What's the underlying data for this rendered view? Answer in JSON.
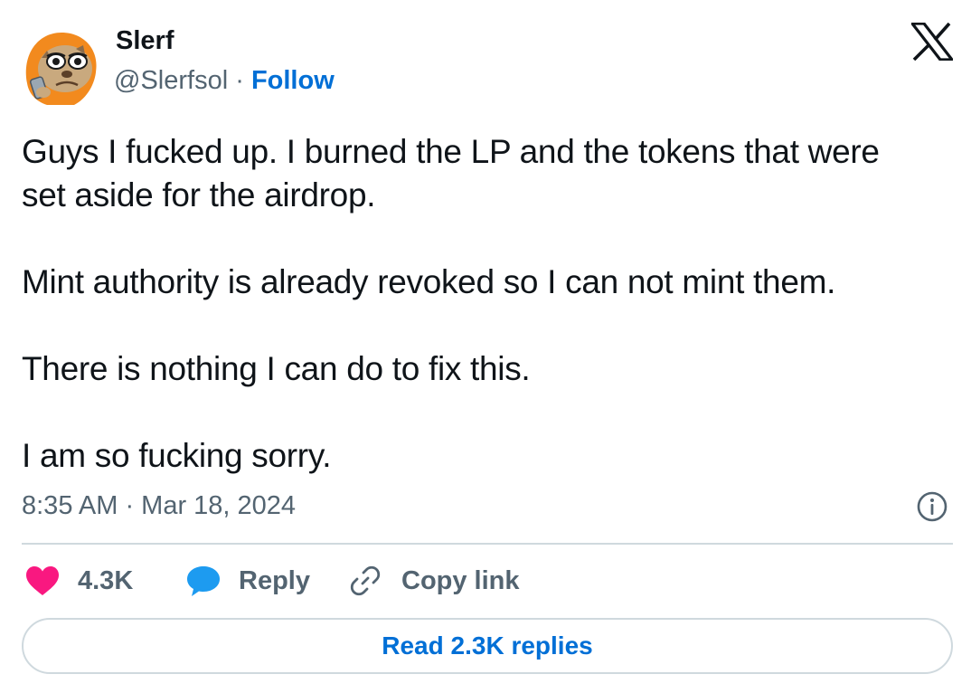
{
  "author": {
    "name": "Slerf",
    "handle": "@Slerfsol",
    "separator": "·",
    "follow_label": "Follow"
  },
  "tweet": {
    "paragraphs": [
      [
        "Guys I fucked up. I burned the LP and the tokens that were",
        "set aside for the airdrop."
      ],
      [
        "Mint authority is already revoked so I can not mint them."
      ],
      [
        "There is nothing I can do to fix this."
      ],
      [
        "I am so fucking sorry."
      ]
    ],
    "timestamp": "8:35 AM · Mar 18, 2024"
  },
  "actions": {
    "like_count": "4.3K",
    "reply_label": "Reply",
    "copy_link_label": "Copy link"
  },
  "read_replies_label": "Read 2.3K replies",
  "icons": {
    "like": "heart-icon",
    "reply": "speech-bubble-icon",
    "copy": "link-icon",
    "info": "info-icon",
    "logo": "x-logo-icon"
  },
  "colors": {
    "like": "#f91880",
    "reply": "#1d9bf0",
    "link": "#006fd6",
    "text": "#0f1419",
    "muted": "#536471",
    "border": "#cfd9de",
    "avatar_hood": "#f28a1e"
  }
}
